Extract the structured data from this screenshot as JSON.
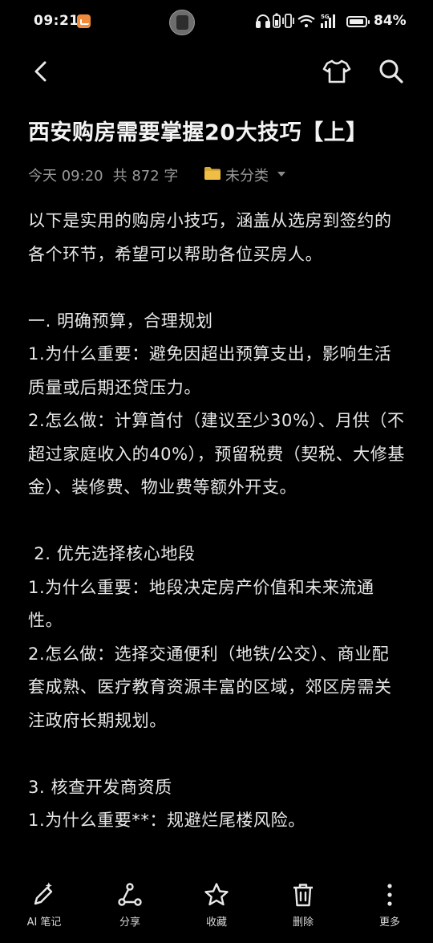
{
  "status_bar": {
    "time": "09:21",
    "battery_percent": "84%",
    "signal_label": "5G",
    "icons": [
      "app-notification-icon",
      "avatar",
      "headphones-icon",
      "battery-saver-icon",
      "vibrate-icon",
      "wifi-icon",
      "signal-icon",
      "battery-icon"
    ]
  },
  "toolbar": {
    "back_icon": "chevron-left-icon",
    "theme_icon": "tshirt-icon",
    "search_icon": "search-icon"
  },
  "note": {
    "title": "西安购房需要掌握20大技巧【上】",
    "date": "今天 09:20",
    "word_count": "共 872 字",
    "folder": "未分类",
    "paragraphs": [
      "以下是实用的购房小技巧，涵盖从选房到签约的各个环节，希望可以帮助各位买房人。",
      "",
      "一. 明确预算，合理规划",
      "1.为什么重要：避免因超出预算支出，影响生活质量或后期还贷压力。",
      "2.怎么做：计算首付（建议至少30%）、月供（不超过家庭收入的40%），预留税费（契税、大修基金）、装修费、物业费等额外开支。",
      "",
      " 2. 优先选择核心地段",
      "1.为什么重要：地段决定房产价值和未来流通性。",
      "2.怎么做：选择交通便利（地铁/公交）、商业配套成熟、医疗教育资源丰富的区域，郊区房需关注政府长期规划。",
      "",
      "3. 核查开发商资质",
      "1.为什么重要**：规避烂尾楼风险。"
    ]
  },
  "bottom_bar": {
    "ai_note": "AI 笔记",
    "share": "分享",
    "favorite": "收藏",
    "delete": "删除",
    "more": "更多"
  }
}
